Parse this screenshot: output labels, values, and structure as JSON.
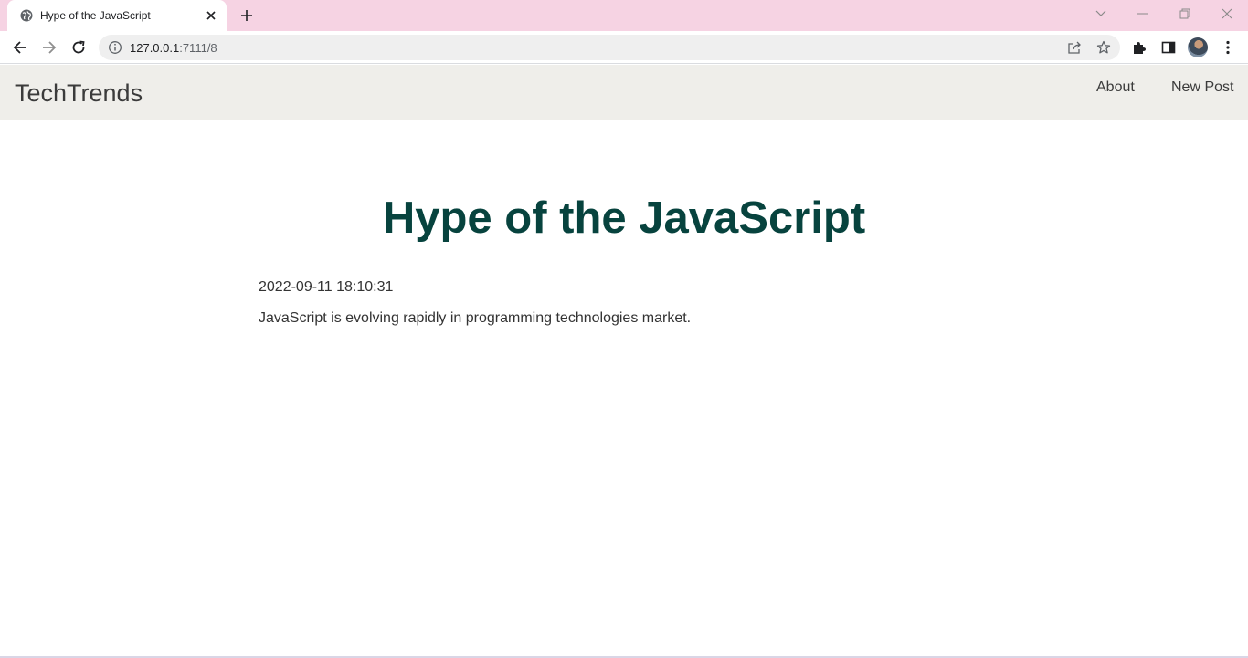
{
  "browser": {
    "tab": {
      "title": "Hype of the JavaScript"
    },
    "address": {
      "host": "127.0.0.1",
      "port_path": ":7111/8"
    },
    "colors": {
      "tabstrip": "#f6d3e3",
      "omnibox": "#efefef"
    }
  },
  "site": {
    "brand": "TechTrends",
    "nav": [
      {
        "label": "About"
      },
      {
        "label": "New Post"
      }
    ],
    "colors": {
      "navbar": "#efeeea",
      "title": "#07433e"
    }
  },
  "post": {
    "title": "Hype of the JavaScript",
    "date": "2022-09-11 18:10:31",
    "body": "JavaScript is evolving rapidly in programming technologies market."
  }
}
